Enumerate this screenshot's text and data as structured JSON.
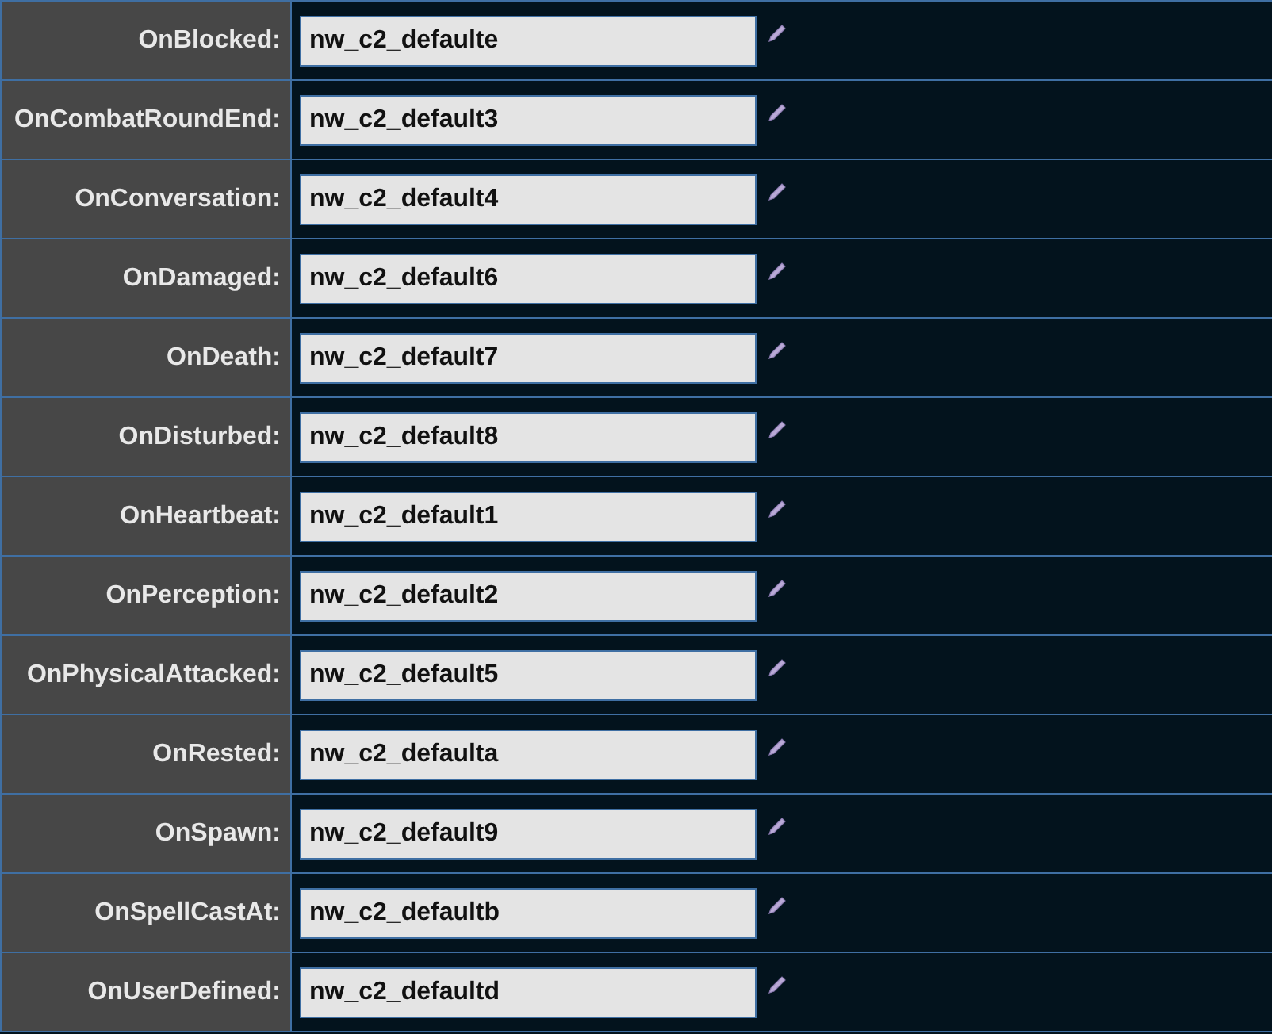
{
  "rows": [
    {
      "label": "OnBlocked:",
      "value": "nw_c2_defaulte"
    },
    {
      "label": "OnCombatRoundEnd:",
      "value": "nw_c2_default3"
    },
    {
      "label": "OnConversation:",
      "value": "nw_c2_default4"
    },
    {
      "label": "OnDamaged:",
      "value": "nw_c2_default6"
    },
    {
      "label": "OnDeath:",
      "value": "nw_c2_default7"
    },
    {
      "label": "OnDisturbed:",
      "value": "nw_c2_default8"
    },
    {
      "label": "OnHeartbeat:",
      "value": "nw_c2_default1"
    },
    {
      "label": "OnPerception:",
      "value": "nw_c2_default2"
    },
    {
      "label": "OnPhysicalAttacked:",
      "value": "nw_c2_default5"
    },
    {
      "label": "OnRested:",
      "value": "nw_c2_defaulta"
    },
    {
      "label": "OnSpawn:",
      "value": "nw_c2_default9"
    },
    {
      "label": "OnSpellCastAt:",
      "value": "nw_c2_defaultb"
    },
    {
      "label": "OnUserDefined:",
      "value": "nw_c2_defaultd"
    }
  ]
}
